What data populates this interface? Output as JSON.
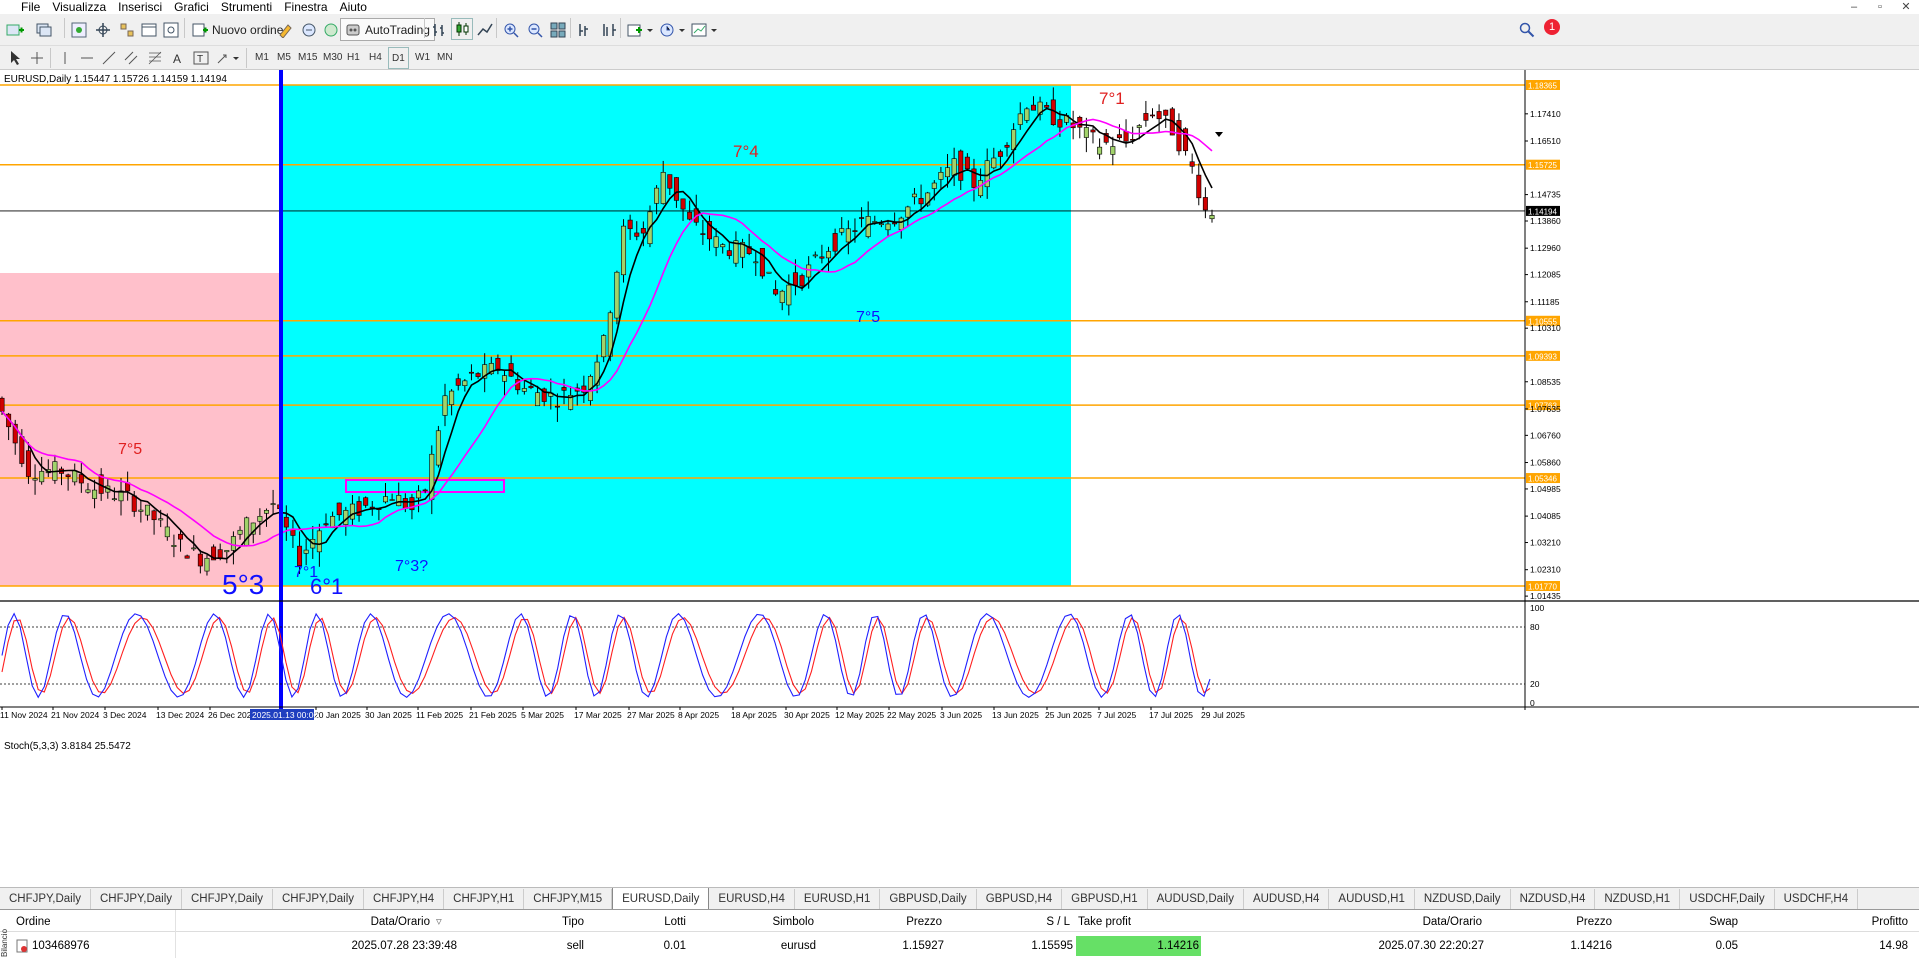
{
  "menu": [
    "File",
    "Visualizza",
    "Inserisci",
    "Grafici",
    "Strumenti",
    "Finestra",
    "Aiuto"
  ],
  "window_controls": [
    "–",
    "▫",
    "✕"
  ],
  "toolbar": {
    "new_order_label": "Nuovo ordine",
    "autotrading_label": "AutoTrading",
    "notification_count": "1"
  },
  "timeframes": [
    "M1",
    "M5",
    "M15",
    "M30",
    "H1",
    "H4",
    "D1",
    "W1",
    "MN"
  ],
  "active_timeframe": "D1",
  "chart": {
    "header": "EURUSD,Daily  1.15447 1.15726 1.14159 1.14194",
    "stoch_label": "Stoch(5,3,3) 3.8184 25.5472",
    "price_ticks": [
      "1.17410",
      "1.16510",
      "1.14735",
      "1.13860",
      "1.12960",
      "1.12085",
      "1.11185",
      "1.10310",
      "1.08535",
      "1.07635",
      "1.06760",
      "1.05860",
      "1.04985",
      "1.04085",
      "1.03210",
      "1.02310",
      "1.01435"
    ],
    "level_labels": [
      "1.18365",
      "1.15725",
      "1.10555",
      "1.09393",
      "1.07763",
      "1.05346",
      "1.01770"
    ],
    "current_price_label": "1.14194",
    "stoch_ticks": [
      "100",
      "80",
      "20",
      "0"
    ],
    "date_ticks": [
      "11 Nov 2024",
      "21 Nov 2024",
      "3 Dec 2024",
      "13 Dec 2024",
      "26 Dec 2024",
      "20 Jan 2025",
      "30 Jan 2025",
      "11 Feb 2025",
      "21 Feb 2025",
      "5 Mar 2025",
      "17 Mar 2025",
      "27 Mar 2025",
      "8 Apr 2025",
      "18 Apr 2025",
      "30 Apr 2025",
      "12 May 2025",
      "22 May 2025",
      "3 Jun 2025",
      "13 Jun 2025",
      "25 Jun 2025",
      "7 Jul 2025",
      "17 Jul 2025",
      "29 Jul 2025"
    ],
    "cursor_date": "2025.01.13 00:00",
    "annotations": [
      "7°5",
      "5°3",
      "7°1",
      "6°1",
      "7°3?",
      "7°4",
      "7°5",
      "7°1"
    ],
    "colors": {
      "cyan_zone": "#00ffff",
      "pink_zone": "#ffc0cb",
      "level_line": "#ffa500",
      "vline": "#0000ff",
      "ma_fast": "#000000",
      "ma_slow": "#ff00ff",
      "bull": "#a2d36b",
      "bear": "#d00000"
    }
  },
  "tabs": [
    "CHFJPY,Daily",
    "CHFJPY,Daily",
    "CHFJPY,Daily",
    "CHFJPY,Daily",
    "CHFJPY,H4",
    "CHFJPY,H1",
    "CHFJPY,M15",
    "EURUSD,Daily",
    "EURUSD,H4",
    "EURUSD,H1",
    "GBPUSD,Daily",
    "GBPUSD,H4",
    "GBPUSD,H1",
    "AUDUSD,Daily",
    "AUDUSD,H4",
    "AUDUSD,H1",
    "NZDUSD,Daily",
    "NZDUSD,H4",
    "NZDUSD,H1",
    "USDCHF,Daily",
    "USDCHF,H4"
  ],
  "active_tab": 7,
  "orders": {
    "headers": {
      "ordine": "Ordine",
      "data_orario": "Data/Orario",
      "tipo": "Tipo",
      "lotti": "Lotti",
      "simbolo": "Simbolo",
      "prezzo": "Prezzo",
      "sl": "S / L",
      "tp": "Take profit",
      "data_orario2": "Data/Orario",
      "prezzo2": "Prezzo",
      "swap": "Swap",
      "profitto": "Profitto"
    },
    "row": {
      "ordine": "103468976",
      "data_orario": "2025.07.28 23:39:48",
      "tipo": "sell",
      "lotti": "0.01",
      "simbolo": "eurusd",
      "prezzo": "1.15927",
      "sl": "1.15595",
      "tp": "1.14216",
      "data_orario2": "2025.07.30 22:20:27",
      "prezzo2": "1.14216",
      "swap": "0.05",
      "profitto": "14.98"
    }
  },
  "side_label": "Bilancio"
}
